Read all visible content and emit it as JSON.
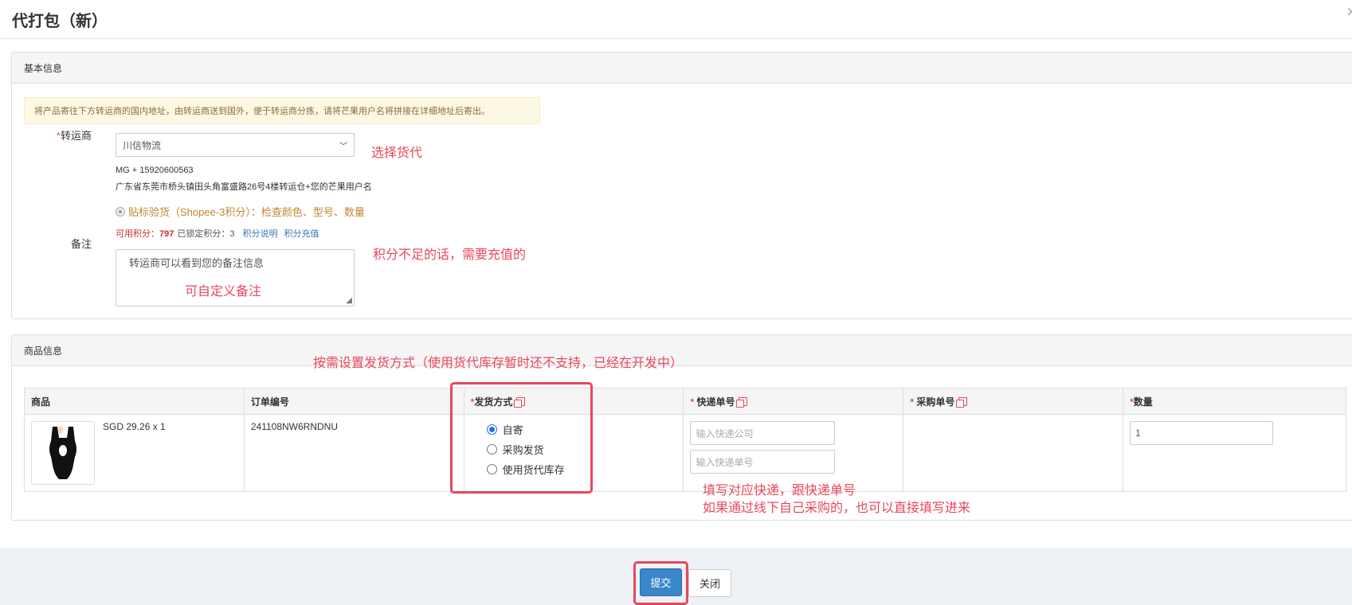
{
  "modal": {
    "title": "代打包（新）",
    "close": "×"
  },
  "basic": {
    "heading": "基本信息",
    "notice": "将产品寄往下方转运商的国内地址，由转运商送到国外，便于转运商分拣，请将芒果用户名将拼接在详细地址后寄出。",
    "forwarder_label": "转运商",
    "forwarder_value": "川信物流",
    "address_line1": "MG + 15920600563",
    "address_line2": "广东省东莞市桥头镇田头角富盛路26号4楼转运仓+您的芒果用户名",
    "service_option": "贴标验货（Shopee-3积分）：检查颜色、型号、数量",
    "points_available_label": "可用积分：",
    "points_available": "797",
    "points_locked": "已锁定积分：3",
    "points_help_link": "积分说明",
    "points_recharge_link": "积分充值",
    "remark_label": "备注",
    "remark_placeholder": "转运商可以看到您的备注信息"
  },
  "goods": {
    "heading": "商品信息",
    "columns": [
      "商品",
      "订单编号",
      "发货方式",
      "快递单号",
      "采购单号",
      "数量"
    ],
    "row": {
      "price": "SGD 29.26 x 1",
      "order_no": "241108NW6RNDNU",
      "ship_options": [
        "自寄",
        "采购发货",
        "使用货代库存"
      ],
      "selected_ship": "自寄",
      "courier_company_placeholder": "输入快递公司",
      "tracking_no_placeholder": "输入快递单号",
      "quantity": "1"
    }
  },
  "annotations": {
    "choose_forwarder": "选择货代",
    "recharge_note": "积分不足的话，需要充值的",
    "custom_remark": "可自定义备注",
    "ship_method_note": "按需设置发货方式（使用货代库存暂时还不支持，已经在开发中）",
    "courier_note_1": "填写对应快递，跟快递单号",
    "courier_note_2": "如果通过线下自己采购的，也可以直接填写进来"
  },
  "footer": {
    "submit": "提交",
    "close": "关闭"
  }
}
